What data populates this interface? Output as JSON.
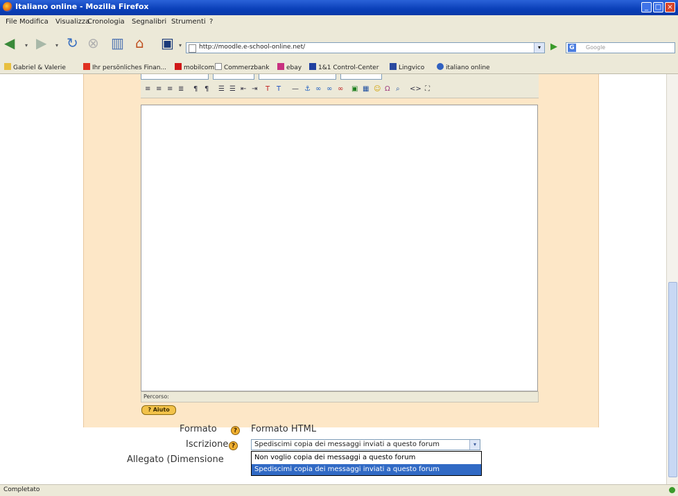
{
  "window": {
    "title": "Italiano online - Mozilla Firefox",
    "controls": {
      "minimize": "_",
      "maximize": "□",
      "close": "×"
    }
  },
  "menu": [
    "File",
    "Modifica",
    "Visualizza",
    "Cronologia",
    "Segnalibri",
    "Strumenti",
    "?"
  ],
  "navigation": {
    "url": "http://moodle.e-school-online.net/",
    "search_placeholder": "Google",
    "search_engine_letter": "G"
  },
  "bookmarks": [
    {
      "label": "Gabriel & Valerie",
      "icon": "folder-icon",
      "color": "#e8c040"
    },
    {
      "label": "Ihr persönliches Finan...",
      "icon": "bank-icon",
      "color": "#e03020"
    },
    {
      "label": "mobilcom",
      "icon": "mobilcom-icon",
      "color": "#d01818"
    },
    {
      "label": "Commerzbank",
      "icon": "page-icon",
      "color": "#ffffff"
    },
    {
      "label": "ebay",
      "icon": "ebay-icon",
      "color": "#c83080"
    },
    {
      "label": "1&1 Control-Center",
      "icon": "control-center-icon",
      "color": "#2040a0"
    },
    {
      "label": "Lingvico",
      "icon": "lingvico-icon",
      "color": "#2a4aa0"
    },
    {
      "label": "italiano online",
      "icon": "italiano-icon",
      "color": "#3060c0"
    }
  ],
  "editor": {
    "path_label": "Percorso:",
    "help_badge": "? Aiuto",
    "toolbar_icons": [
      "align-left-icon",
      "align-center-icon",
      "align-right-icon",
      "justify-icon",
      "ltr-icon",
      "rtl-icon",
      "numbered-list-icon",
      "bullet-list-icon",
      "outdent-icon",
      "indent-icon",
      "text-color-icon",
      "bg-color-icon",
      "hr-icon",
      "anchor-icon",
      "link-icon",
      "unlink-icon",
      "nolink-icon",
      "image-icon",
      "table-icon",
      "smiley-icon",
      "special-char-icon",
      "search-replace-icon",
      "html-source-icon",
      "fullscreen-icon"
    ]
  },
  "form": {
    "formato": {
      "label": "Formato",
      "value": "Formato HTML"
    },
    "iscrizione": {
      "label": "Iscrizione",
      "selected": "Spediscimi copia dei messaggi inviati a questo forum",
      "options": [
        "Non voglio copia dei messaggi a questo forum",
        "Spediscimi copia dei messaggi inviati a questo forum"
      ]
    },
    "allegato": {
      "label": "Allegato (Dimensione"
    }
  },
  "status": {
    "text": "Completato"
  },
  "colors": {
    "title_bar": "#0a3fb8",
    "chrome": "#ece9d8",
    "form_background": "#fde7c7",
    "selection": "#316ac5"
  }
}
